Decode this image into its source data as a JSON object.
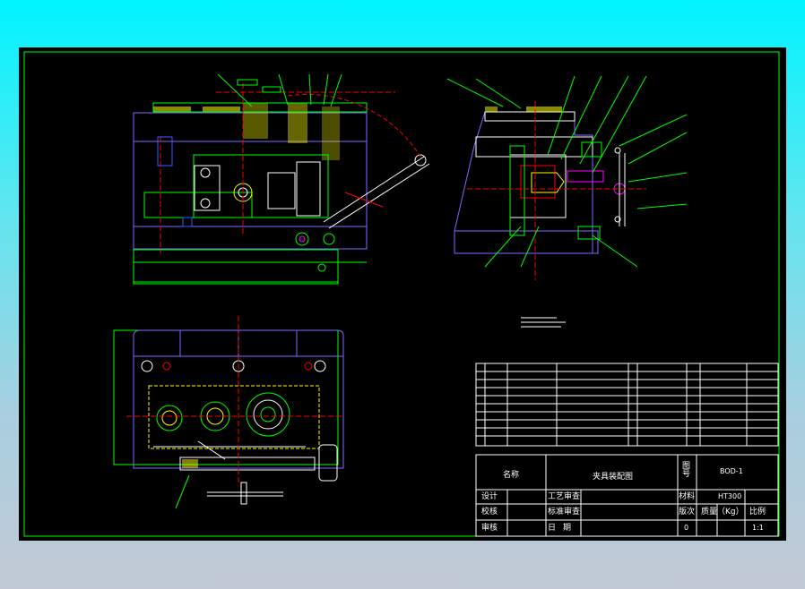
{
  "title_block": {
    "name_label": "名称",
    "drawing_name": "夹具装配图",
    "drawing_no_label": "图号",
    "drawing_no": "BOD-1",
    "material_label": "材料",
    "material": "HT300",
    "batch_label": "版次",
    "mass_label": "质量（Kg）",
    "scale_label": "比例",
    "batch_value": "0",
    "scale_value": "1:1",
    "design_label": "设计",
    "check_label": "校核",
    "audit_label": "审核",
    "process_label": "工艺审查",
    "std_label": "标准审查",
    "date_label": "日期"
  },
  "colors": {
    "sheet": "#000000",
    "frame": "#00ff00",
    "part": "#ffffff",
    "hidden": "#ff0000",
    "hatch": "#ffff00",
    "blue": "#3a5bff",
    "cyan": "#00ffff",
    "magenta": "#ff00ff"
  }
}
